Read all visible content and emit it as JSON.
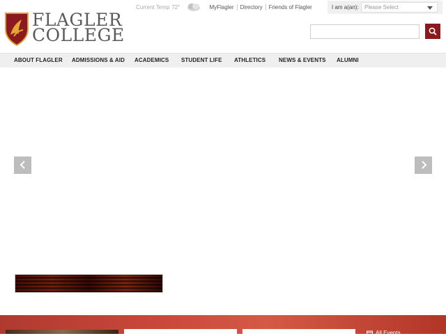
{
  "logo": {
    "line1": "FLAGLER",
    "line2": "COLLEGE"
  },
  "utility": {
    "temp_label": "Current Temp",
    "temp_value": "72°",
    "links": [
      "MyFlagler",
      "Directory",
      "Friends of Flagler"
    ]
  },
  "iam": {
    "label": "I am a(an):",
    "placeholder": "Please Select"
  },
  "search": {
    "value": ""
  },
  "nav": {
    "items": [
      "ABOUT FLAGLER",
      "ADMISSIONS & AID",
      "ACADEMICS",
      "STUDENT LIFE",
      "ATHLETICS",
      "NEWS & EVENTS",
      "ALUMNI"
    ]
  },
  "events": {
    "all_label": "All Events"
  },
  "colors": {
    "brand": "#8b1a1f",
    "nav_bg": "#efefef",
    "band": "#c9473a"
  }
}
